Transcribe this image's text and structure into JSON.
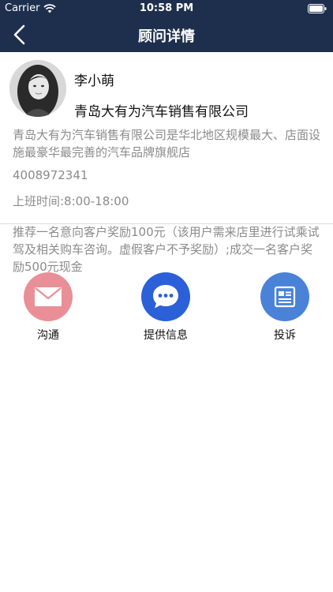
{
  "status_bar": {
    "carrier": "Carrier",
    "time": "10:58 PM"
  },
  "nav": {
    "title": "顾问详情",
    "back_icon": "back-chevron-icon"
  },
  "consultant": {
    "name": "李小萌",
    "company": "青岛大有为汽车销售有限公司",
    "description": "青岛大有为汽车销售有限公司是华北地区规模最大、店面设施最豪华最完善的汽车品牌旗舰店",
    "phone": "4008972341",
    "hours": "上班时间:8:00-18:00",
    "reward": "推荐一名意向客户奖励100元（该用户需来店里进行试乘试驾及相关购车咨询。虚假客户不予奖励）;成交一名客户奖励500元现金"
  },
  "actions": [
    {
      "label": "沟通",
      "icon": "mail-icon",
      "color": "#e98f97"
    },
    {
      "label": "提供信息",
      "icon": "chat-bubble-icon",
      "color": "#2b60d9"
    },
    {
      "label": "投诉",
      "icon": "document-icon",
      "color": "#4a82d8"
    }
  ],
  "colors": {
    "nav_background": "#1e2f4e",
    "muted_text": "#8b8b8b"
  }
}
